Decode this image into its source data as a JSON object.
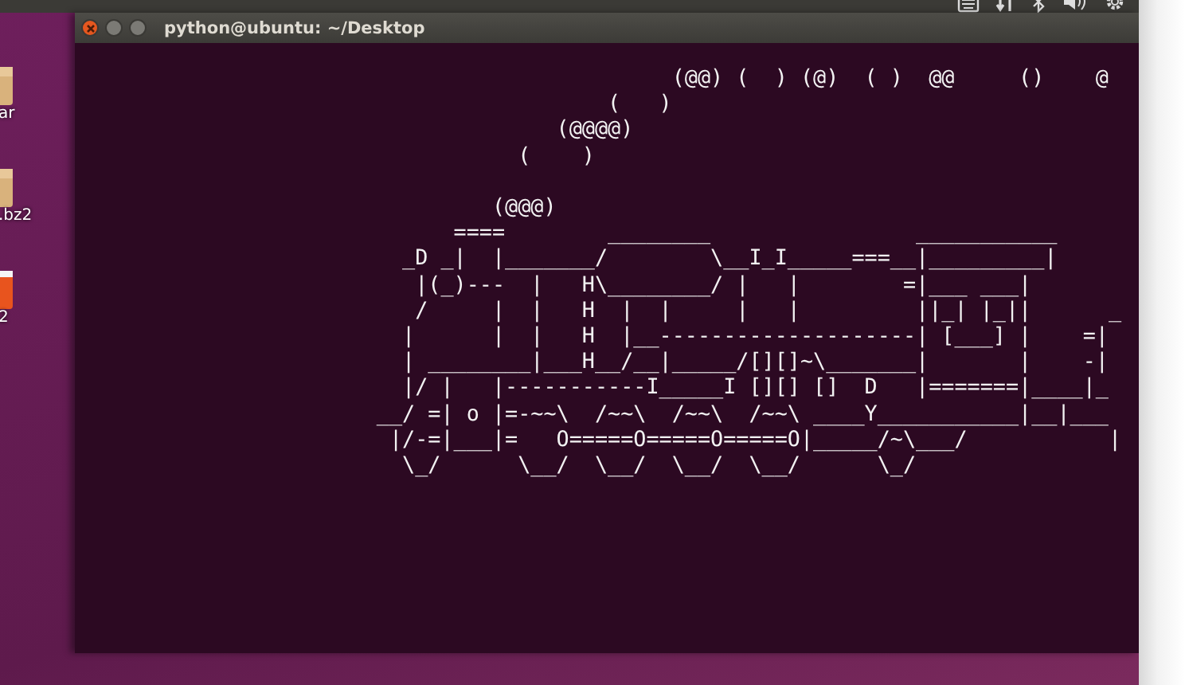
{
  "desktop_icons": [
    {
      "kind": "archive",
      "label": "ar"
    },
    {
      "kind": "archive",
      "label": ".bz2"
    },
    {
      "kind": "package",
      "label": "2"
    }
  ],
  "window": {
    "title": "python@ubuntu: ~/Desktop"
  },
  "terminal": {
    "output": "                                              (@@) (  ) (@)  ( )  @@     ()    @\n                                         (   )\n                                     (@@@@)\n                                  (    )\n\n                                (@@@)\n                             ====        ________                ___________\n                         _D _|  |_______/        \\__I_I_____===__|_________|\n                          |(_)---  |   H\\________/ |   |        =|___ ___|\n                          /     |  |   H  |  |     |   |         ||_| |_||      _\n                         |      |  |   H  |__--------------------| [___] |    =|\n                         | ________|___H__/__|_____/[][]~\\_______|       |    -|\n                         |/ |   |-----------I_____I [][] []  D   |=======|____|_\n                       __/ =| o |=-~~\\  /~~\\  /~~\\  /~~\\ ____Y___________|__|___\n                        |/-=|___|=   O=====O=====O=====O|_____/~\\___/           |\n                         \\_/      \\__/  \\__/  \\__/  \\__/      \\_/"
  }
}
